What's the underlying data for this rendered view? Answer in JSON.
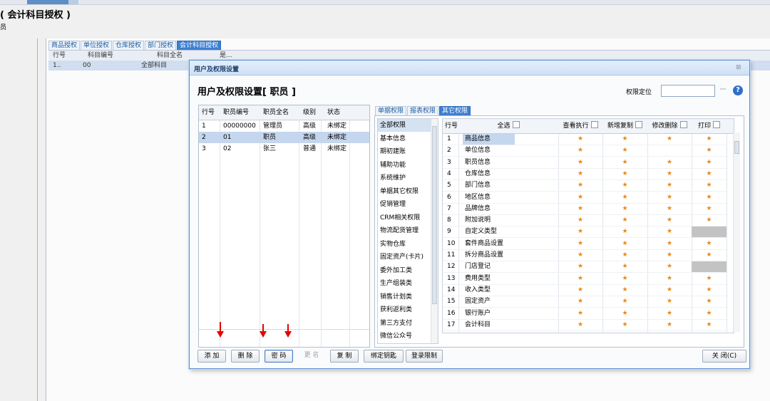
{
  "page": {
    "title": "( 会计科目授权 )",
    "subtitle": "员",
    "tabs": [
      "商品授权",
      "单位授权",
      "仓库授权",
      "部门授权",
      "会计科目授权"
    ],
    "active_tab": 4,
    "grid_headers": [
      "行号",
      "科目编号",
      "科目全名",
      "是..."
    ],
    "grid_row": {
      "row": "1..",
      "code": "00",
      "name": "全部科目"
    }
  },
  "dialog": {
    "title": "用户及权限设置",
    "close_glyph": "⊠",
    "heading": "用户及权限设置[ 职员 ]",
    "locate_label": "权限定位",
    "locate_value": "",
    "locate_button": "···",
    "help": "?"
  },
  "staff": {
    "headers": [
      "行号",
      "职员编号",
      "职员全名",
      "级别",
      "状态"
    ],
    "rows": [
      {
        "row": "1",
        "code": "00000000",
        "name": "管理员",
        "level": "高级",
        "status": "未绑定"
      },
      {
        "row": "2",
        "code": "01",
        "name": "职员",
        "level": "高级",
        "status": "未绑定"
      },
      {
        "row": "3",
        "code": "02",
        "name": "张三",
        "level": "普通",
        "status": "未绑定"
      }
    ],
    "selected": 1
  },
  "right_tabs": [
    "单据权限",
    "报表权限",
    "其它权限"
  ],
  "right_active": 2,
  "categories": [
    "全部权限",
    "基本信息",
    "期初建账",
    "辅助功能",
    "系统维护",
    "单据其它权限",
    "促销管理",
    "CRM相关权限",
    "物流配货管理",
    "实物仓库",
    "固定资产(卡片)",
    "委外加工类",
    "生产组装类",
    "销售计划类",
    "获利返利类",
    "第三方支付",
    "微信公众号"
  ],
  "perm_grid": {
    "headers": {
      "row": "行号",
      "select_all": "全选",
      "view": "查看执行",
      "add": "新增复制",
      "edit": "修改删除",
      "print": "打印"
    },
    "star": "★",
    "rows": [
      {
        "row": "1",
        "name": "商品信息",
        "cells": [
          "s",
          "s",
          "s",
          "s"
        ]
      },
      {
        "row": "2",
        "name": "单位信息",
        "cells": [
          "s",
          "s",
          "",
          "s"
        ]
      },
      {
        "row": "3",
        "name": "职员信息",
        "cells": [
          "s",
          "s",
          "s",
          "s"
        ]
      },
      {
        "row": "4",
        "name": "仓库信息",
        "cells": [
          "s",
          "s",
          "s",
          "s"
        ]
      },
      {
        "row": "5",
        "name": "部门信息",
        "cells": [
          "s",
          "s",
          "s",
          "s"
        ]
      },
      {
        "row": "6",
        "name": "地区信息",
        "cells": [
          "s",
          "s",
          "s",
          "s"
        ]
      },
      {
        "row": "7",
        "name": "品牌信息",
        "cells": [
          "s",
          "s",
          "s",
          "s"
        ]
      },
      {
        "row": "8",
        "name": "附加说明",
        "cells": [
          "s",
          "s",
          "s",
          "s"
        ]
      },
      {
        "row": "9",
        "name": "自定义类型",
        "cells": [
          "s",
          "s",
          "s",
          "g"
        ]
      },
      {
        "row": "10",
        "name": "套件商品设置",
        "cells": [
          "s",
          "s",
          "s",
          "s"
        ]
      },
      {
        "row": "11",
        "name": "拆分商品设置",
        "cells": [
          "s",
          "s",
          "s",
          "s"
        ]
      },
      {
        "row": "12",
        "name": "门店登记",
        "cells": [
          "s",
          "s",
          "s",
          "g"
        ]
      },
      {
        "row": "13",
        "name": "费用类型",
        "cells": [
          "s",
          "s",
          "s",
          "s"
        ]
      },
      {
        "row": "14",
        "name": "收入类型",
        "cells": [
          "s",
          "s",
          "s",
          "s"
        ]
      },
      {
        "row": "15",
        "name": "固定资产",
        "cells": [
          "s",
          "s",
          "s",
          "s"
        ]
      },
      {
        "row": "16",
        "name": "银行账户",
        "cells": [
          "s",
          "s",
          "s",
          "s"
        ]
      },
      {
        "row": "17",
        "name": "会计科目",
        "cells": [
          "s",
          "s",
          "s",
          "s"
        ]
      }
    ],
    "selected": 0
  },
  "buttons": {
    "add": "添 加",
    "delete": "删 除",
    "password": "密 码",
    "rename": "更 名",
    "copy": "复 制",
    "bind_key": "绑定钥匙",
    "login_limit": "登录限制",
    "close": "关 闭(C)"
  },
  "colors": {
    "accent": "#3d7fd0",
    "star": "#e9891a",
    "arrow": "#e60000"
  }
}
